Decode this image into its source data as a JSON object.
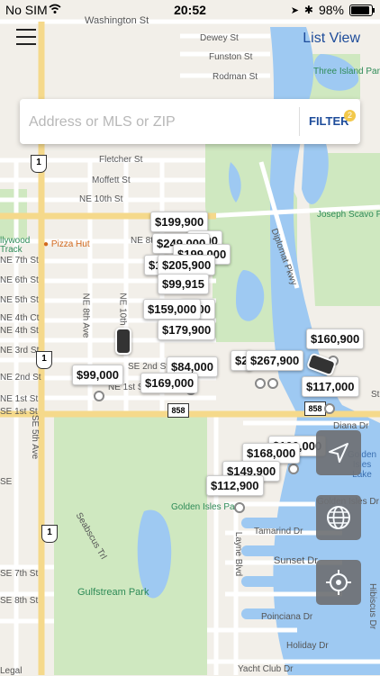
{
  "status_bar": {
    "carrier": "No SIM",
    "time": "20:52",
    "battery": "98%"
  },
  "header": {
    "list_view_label": "List View"
  },
  "search": {
    "placeholder": "Address or MLS or ZIP",
    "filter_label": "FILTER",
    "filter_badge": "2"
  },
  "map_labels": {
    "washington": "Washington St",
    "dewey": "Dewey St",
    "funston": "Funston St",
    "rodman": "Rodman St",
    "three_island": "Three Island Park",
    "fletcher": "Fletcher St",
    "moffett": "Moffett St",
    "ne10th": "NE 10th St",
    "joseph": "Joseph Scavo Park",
    "hollywood": "llywood",
    "track": "Track",
    "pizza": "Pizza Hut",
    "ne8th": "NE 8th St",
    "ne7th": "NE 7th St",
    "ne6th": "NE 6th St",
    "ne5th": "NE 5th St",
    "ne4th": "NE 4th Ct",
    "ne4st": "NE 4th St",
    "ne3rd": "NE 3rd St",
    "ne2nd": "NE 2nd St",
    "ne1st": "NE 1st St",
    "ne1stb": "NE 1st St",
    "ne8ave": "NE 8th Ave",
    "ne10th_ave": "NE 10th",
    "diplomat": "Diplomat Pkwy",
    "diana": "Diana Dr",
    "golden_isles_lake": "Golden Isles Lake",
    "golden_isles_park": "Golden Isles Park",
    "golden_isles_dr": "Golden Isles Dr",
    "tamarind": "Tamarind Dr",
    "sunset": "Sunset Dr",
    "poinciana": "Poinciana Dr",
    "holiday": "Holiday Dr",
    "yacht_club": "Yacht Club Dr",
    "hibiscus": "Hibiscus Dr",
    "seabscus": "Seabscus Trl",
    "layne": "Layne Blvd",
    "se5th": "SE 5th Ave",
    "gulfstream": "Gulfstream Park",
    "se7th": "SE 7th St",
    "se8th": "SE 8th St",
    "legal": "Legal",
    "se_left": "SE",
    "se1st": "SE 1st St",
    "se2nd": "SE 2nd St",
    "st": "St"
  },
  "route_shields": {
    "us1": "1",
    "sr858": "858"
  },
  "listings": [
    {
      "price": "$199,900"
    },
    {
      "price": "$249,000"
    },
    {
      "price": "0000"
    },
    {
      "price": "$199,000"
    },
    {
      "price": "$1!"
    },
    {
      "price": "$205,900"
    },
    {
      "price": "$99,915"
    },
    {
      "price": "0000"
    },
    {
      "price": "$159,000"
    },
    {
      "price": "$179,900"
    },
    {
      "price": "$2"
    },
    {
      "price": "$267,900"
    },
    {
      "price": "$160,900"
    },
    {
      "price": "$99,000"
    },
    {
      "price": "$84,000"
    },
    {
      "price": "$169,000"
    },
    {
      "price": "$117,000"
    },
    {
      "price": "$168,000"
    },
    {
      "price": "$100,000"
    },
    {
      "price": "$149,900"
    },
    {
      "price": "$112,900"
    }
  ],
  "controls": {
    "locate_icon": "navigation-arrow-icon",
    "globe_icon": "globe-icon",
    "crosshair_icon": "crosshair-icon"
  },
  "colors": {
    "accent": "#1e4c9a",
    "park": "#cfe8c0",
    "water": "#9ec9f2",
    "road": "#ffffff",
    "highway": "#f5d98b"
  }
}
